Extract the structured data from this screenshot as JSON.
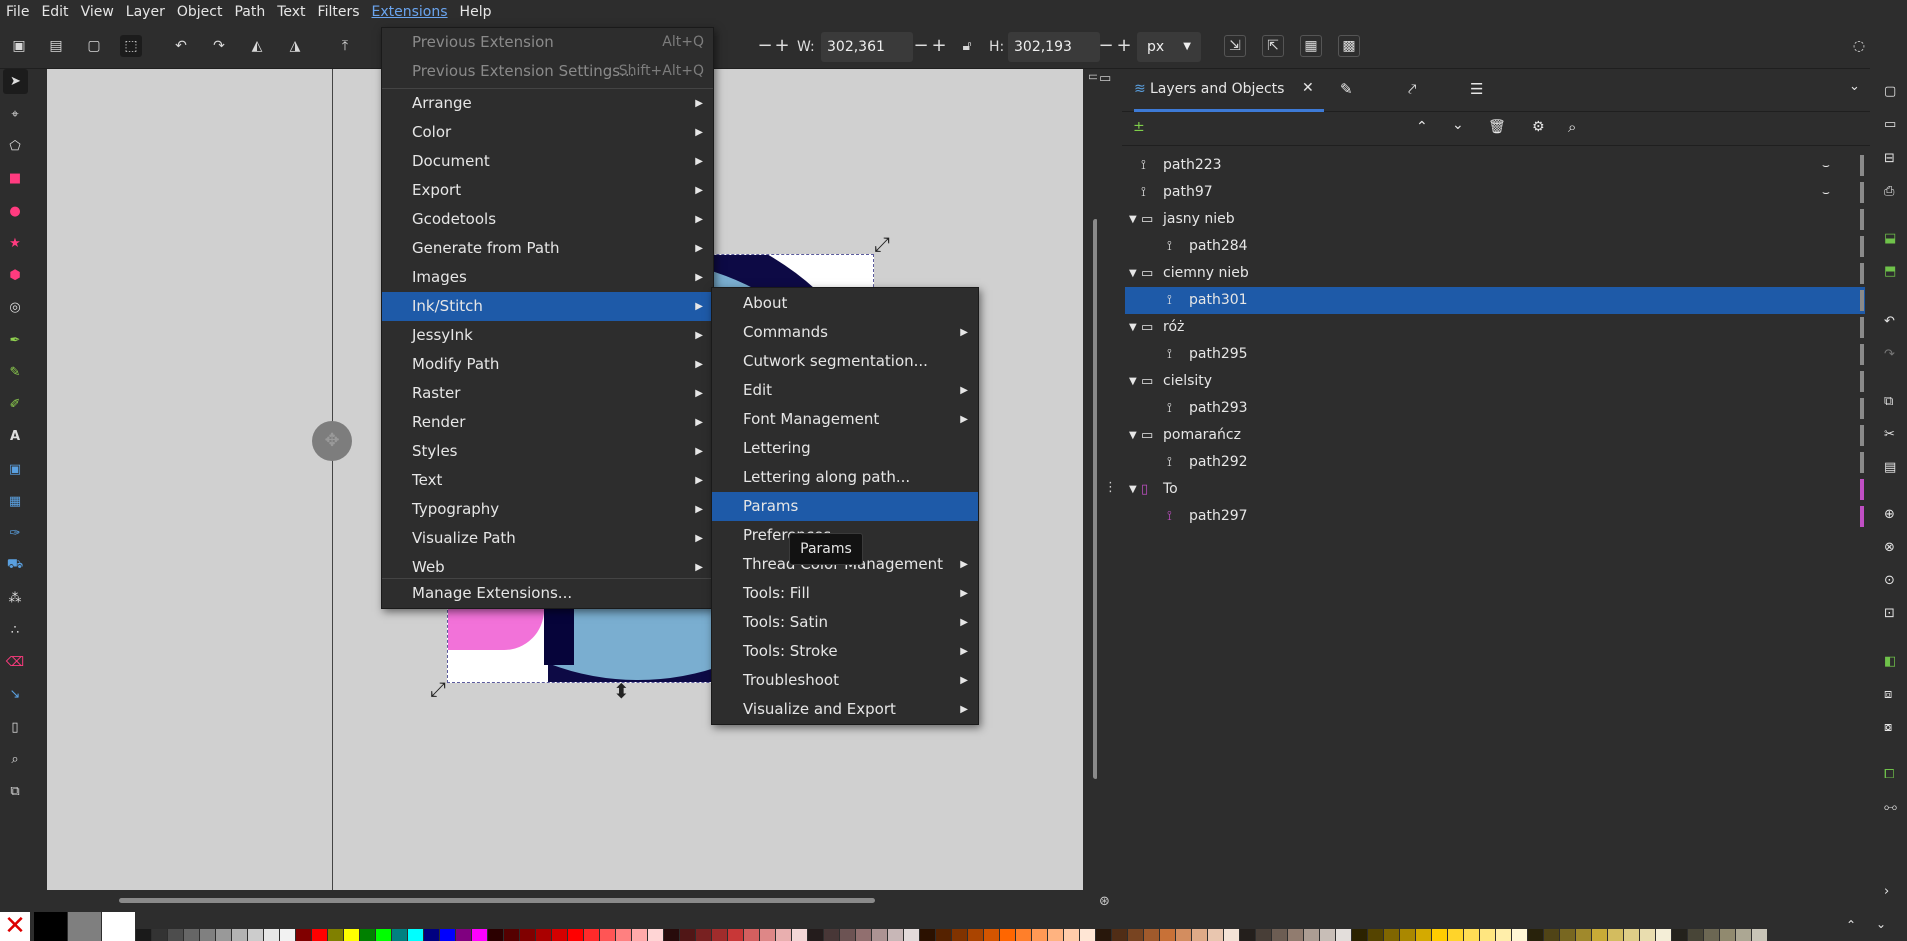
{
  "menubar": {
    "file": "File",
    "edit": "Edit",
    "view": "View",
    "layer": "Layer",
    "object": "Object",
    "path": "Path",
    "text": "Text",
    "filters": "Filters",
    "extensions": "Extensions",
    "help": "Help"
  },
  "toolbar": {
    "w_label": "W:",
    "w_value": "302,361",
    "h_label": "H:",
    "h_value": "302,193",
    "unit": "px",
    "minus": "−",
    "plus": "+"
  },
  "extensions_menu": {
    "previous_extension": "Previous Extension",
    "previous_extension_shortcut": "Alt+Q",
    "previous_extension_settings": "Previous Extension Settings...",
    "previous_extension_settings_shortcut": "Shift+Alt+Q",
    "items": [
      "Arrange",
      "Color",
      "Document",
      "Export",
      "Gcodetools",
      "Generate from Path",
      "Images",
      "Ink/Stitch",
      "JessyInk",
      "Modify Path",
      "Raster",
      "Render",
      "Styles",
      "Text",
      "Typography",
      "Visualize Path",
      "Web"
    ],
    "manage": "Manage Extensions..."
  },
  "inkstitch_menu": {
    "items": [
      {
        "label": "About",
        "sub": false
      },
      {
        "label": "Commands",
        "sub": true
      },
      {
        "label": "Cutwork segmentation...",
        "sub": false
      },
      {
        "label": "Edit",
        "sub": true
      },
      {
        "label": "Font Management",
        "sub": true
      },
      {
        "label": "Lettering",
        "sub": false
      },
      {
        "label": "Lettering along path...",
        "sub": false
      },
      {
        "label": "Params",
        "sub": false
      },
      {
        "label": "Preferences",
        "sub": false
      },
      {
        "label": "Thread Color Management",
        "sub": true
      },
      {
        "label": "Tools: Fill",
        "sub": true
      },
      {
        "label": "Tools: Satin",
        "sub": true
      },
      {
        "label": "Tools: Stroke",
        "sub": true
      },
      {
        "label": "Troubleshoot",
        "sub": true
      },
      {
        "label": "Visualize and Export",
        "sub": true
      }
    ]
  },
  "tooltip": "Params",
  "panel": {
    "tab_title": "Layers and Objects",
    "rows": [
      {
        "label": "path223",
        "type": "path",
        "indent": 0,
        "hidden": true
      },
      {
        "label": "path97",
        "type": "path",
        "indent": 0,
        "hidden": true
      },
      {
        "label": "jasny nieb",
        "type": "group",
        "indent": 0
      },
      {
        "label": "path284",
        "type": "path",
        "indent": 1
      },
      {
        "label": "ciemny nieb",
        "type": "group",
        "indent": 0
      },
      {
        "label": "path301",
        "type": "path",
        "indent": 1,
        "selected": true
      },
      {
        "label": "róż",
        "type": "group",
        "indent": 0
      },
      {
        "label": "path295",
        "type": "path",
        "indent": 1
      },
      {
        "label": "cielsity",
        "type": "group",
        "indent": 0
      },
      {
        "label": "path293",
        "type": "path",
        "indent": 1
      },
      {
        "label": "pomarańcz",
        "type": "group",
        "indent": 0
      },
      {
        "label": "path292",
        "type": "path",
        "indent": 1
      },
      {
        "label": "To",
        "type": "layer",
        "indent": 0
      },
      {
        "label": "path297",
        "type": "path",
        "indent": 1
      }
    ]
  },
  "colors": {
    "accent": "#1e5aa8",
    "menu_bg": "#2d2d2d",
    "canvas_bg": "#d0d0d0",
    "layer_marker": "#c04fc4"
  },
  "palette": [
    "#000000",
    "#7f7f7f",
    "#ffffff",
    "#1a1a1a",
    "#333333",
    "#4d4d4d",
    "#666666",
    "#808080",
    "#999999",
    "#b3b3b3",
    "#cccccc",
    "#e6e6e6",
    "#f2f2f2",
    "#800000",
    "#ff0000",
    "#808000",
    "#ffff00",
    "#008000",
    "#00ff00",
    "#008080",
    "#00ffff",
    "#000080",
    "#0000ff",
    "#800080",
    "#ff00ff",
    "#2b0000",
    "#550000",
    "#800000",
    "#aa0000",
    "#d40000",
    "#ff0000",
    "#ff2a2a",
    "#ff5555",
    "#ff8080",
    "#ffaaaa",
    "#ffd5d5",
    "#280b0b",
    "#501616",
    "#782121",
    "#a02c2c",
    "#c83737",
    "#d35f5f",
    "#de8787",
    "#e9afaf",
    "#f4d7d7",
    "#241c1c",
    "#483737",
    "#6c5353",
    "#916f6f",
    "#ac9393",
    "#c8b7b7",
    "#e3dbdb",
    "#2b1100",
    "#552200",
    "#803300",
    "#aa4400",
    "#d45500",
    "#ff6600",
    "#ff7f2a",
    "#ff9955",
    "#ffb380",
    "#ffccaa",
    "#ffe6d5",
    "#28170b",
    "#502d16",
    "#784421",
    "#a05a2c",
    "#c87137",
    "#d38d5f",
    "#deaa87",
    "#e9c6af",
    "#f4e3d7",
    "#241f1c",
    "#483e37",
    "#6c5d53",
    "#917c6f",
    "#ac9d93",
    "#c8beb7",
    "#e3dedb",
    "#2b2200",
    "#554400",
    "#806600",
    "#aa8800",
    "#d4aa00",
    "#ffcc00",
    "#ffd42a",
    "#ffdd55",
    "#ffe680",
    "#ffeeaa",
    "#fff6d5",
    "#28220b",
    "#504416",
    "#786721",
    "#a0892c",
    "#c8ab37",
    "#d3bc5f",
    "#decd87",
    "#e9ddaf",
    "#f4eed7",
    "#24221c",
    "#484537",
    "#6c6753",
    "#918a6f",
    "#aca793",
    "#c8c4b7"
  ]
}
